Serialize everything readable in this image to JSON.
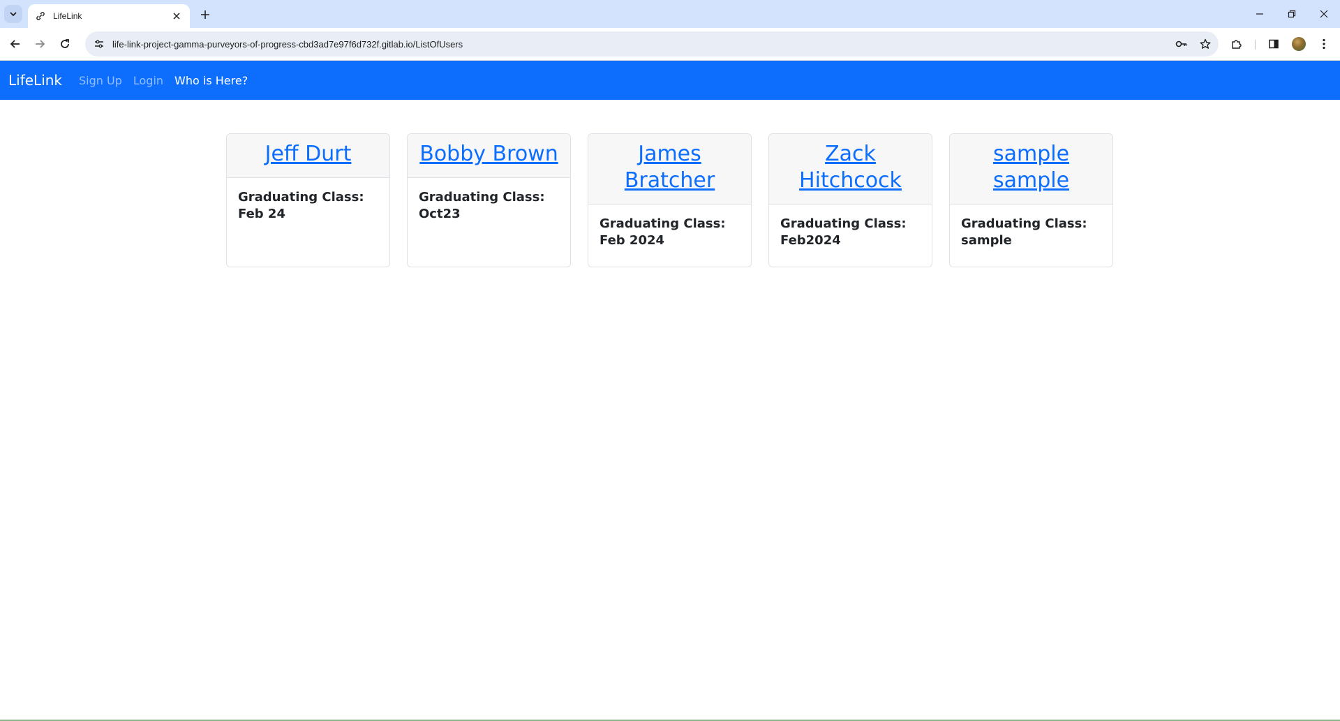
{
  "browser": {
    "tab_title": "LifeLink",
    "url": "life-link-project-gamma-purveyors-of-progress-cbd3ad7e97f6d732f.gitlab.io/ListOfUsers"
  },
  "navbar": {
    "brand": "LifeLink",
    "links": [
      {
        "label": "Sign Up",
        "active": false
      },
      {
        "label": "Login",
        "active": false
      },
      {
        "label": "Who is Here?",
        "active": true
      }
    ],
    "background_color": "#0d6efd"
  },
  "users": [
    {
      "name": "Jeff Durt",
      "class_text": "Graduating Class: Feb 24"
    },
    {
      "name": "Bobby Brown",
      "class_text": "Graduating Class: Oct23"
    },
    {
      "name": "James Bratcher",
      "class_text": "Graduating Class: Feb 2024"
    },
    {
      "name": "Zack Hitchcock",
      "class_text": "Graduating Class: Feb2024"
    },
    {
      "name": "sample sample",
      "class_text": "Graduating Class: sample"
    }
  ],
  "icons": {
    "tab_search": "chevron-down-icon",
    "favicon": "link-icon",
    "tab_close": "close-icon",
    "new_tab": "plus-icon",
    "back": "arrow-left-icon",
    "forward": "arrow-right-icon",
    "reload": "reload-icon",
    "site_info": "tune-icon",
    "password": "key-icon",
    "bookmark": "star-icon",
    "extensions": "puzzle-icon",
    "side_panel": "side-panel-icon",
    "menu": "kebab-menu-icon"
  }
}
